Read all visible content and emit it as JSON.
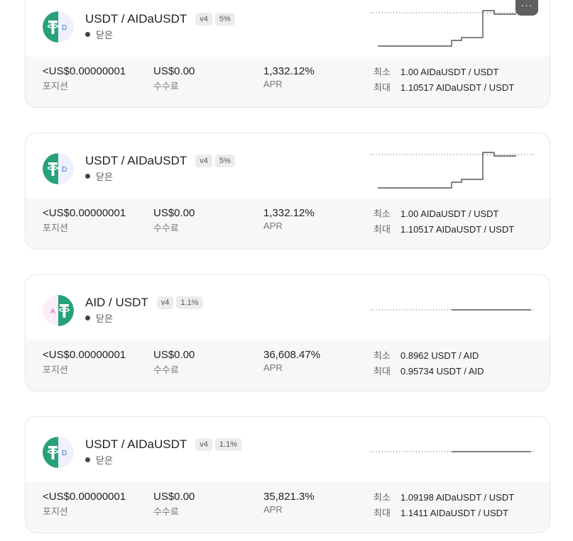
{
  "positions": [
    {
      "pair": "USDT / AIDaUSDT",
      "version": "v4",
      "fee_tier": "5%",
      "status": "닫은",
      "icon_letter": "D",
      "value": "<US$0.00000001",
      "value_label": "포지션",
      "fees": "US$0.00",
      "fees_label": "수수료",
      "apr": "1,332.12%",
      "apr_label": "APR",
      "min_label": "최소",
      "min": "1.00 AIDaUSDT / USDT",
      "max_label": "최대",
      "max": "1.10517 AIDaUSDT / USDT",
      "more_label": "···"
    },
    {
      "pair": "USDT / AIDaUSDT",
      "version": "v4",
      "fee_tier": "5%",
      "status": "닫은",
      "icon_letter": "D",
      "value": "<US$0.00000001",
      "value_label": "포지션",
      "fees": "US$0.00",
      "fees_label": "수수료",
      "apr": "1,332.12%",
      "apr_label": "APR",
      "min_label": "최소",
      "min": "1.00 AIDaUSDT / USDT",
      "max_label": "최대",
      "max": "1.10517 AIDaUSDT / USDT"
    },
    {
      "pair": "AID / USDT",
      "version": "v4",
      "fee_tier": "1.1%",
      "status": "닫은",
      "icon_letter": "A",
      "value": "<US$0.00000001",
      "value_label": "포지션",
      "fees": "US$0.00",
      "fees_label": "수수료",
      "apr": "36,608.47%",
      "apr_label": "APR",
      "min_label": "최소",
      "min": "0.8962 USDT / AID",
      "max_label": "최대",
      "max": "0.95734 USDT / AID"
    },
    {
      "pair": "USDT / AIDaUSDT",
      "version": "v4",
      "fee_tier": "1.1%",
      "status": "닫은",
      "icon_letter": "D",
      "value": "<US$0.00000001",
      "value_label": "포지션",
      "fees": "US$0.00",
      "fees_label": "수수료",
      "apr": "35,821.3%",
      "apr_label": "APR",
      "min_label": "최소",
      "min": "1.09198 AIDaUSDT / USDT",
      "max_label": "최대",
      "max": "1.1411 AIDaUSDT / USDT"
    }
  ],
  "colors": {
    "tether_green": "#26a17b",
    "aid_pink": "#e05ad0",
    "dai_blue": "#3b6fd8"
  }
}
